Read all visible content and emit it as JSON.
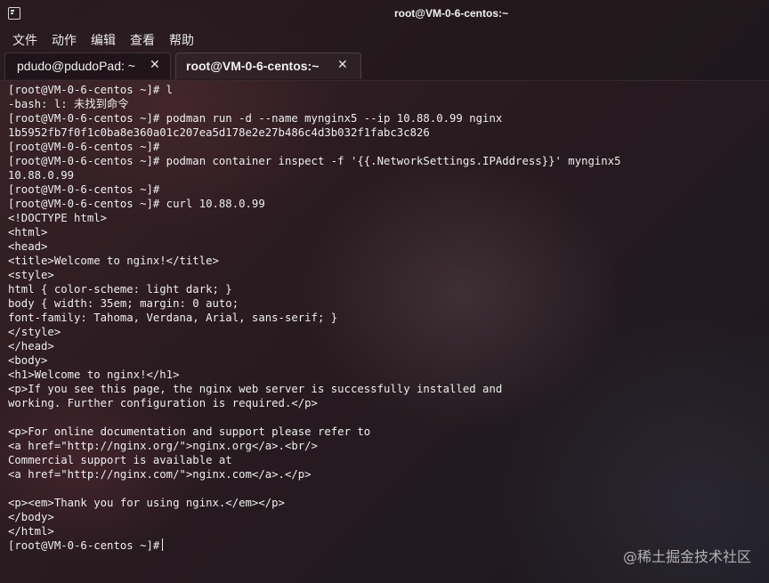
{
  "window": {
    "title": "root@VM-0-6-centos:~"
  },
  "menu": {
    "items": [
      "文件",
      "动作",
      "编辑",
      "查看",
      "帮助"
    ]
  },
  "tabs": [
    {
      "label": "pdudo@pdudoPad: ~",
      "close": "✕",
      "active": false
    },
    {
      "label": "root@VM-0-6-centos:~",
      "close": "✕",
      "active": true
    }
  ],
  "terminal": {
    "lines": [
      "[root@VM-0-6-centos ~]# l",
      "-bash: l: 未找到命令",
      "[root@VM-0-6-centos ~]# podman run -d --name mynginx5 --ip 10.88.0.99 nginx",
      "1b5952fb7f0f1c0ba8e360a01c207ea5d178e2e27b486c4d3b032f1fabc3c826",
      "[root@VM-0-6-centos ~]#",
      "[root@VM-0-6-centos ~]# podman container inspect -f '{{.NetworkSettings.IPAddress}}' mynginx5",
      "10.88.0.99",
      "[root@VM-0-6-centos ~]#",
      "[root@VM-0-6-centos ~]# curl 10.88.0.99",
      "<!DOCTYPE html>",
      "<html>",
      "<head>",
      "<title>Welcome to nginx!</title>",
      "<style>",
      "html { color-scheme: light dark; }",
      "body { width: 35em; margin: 0 auto;",
      "font-family: Tahoma, Verdana, Arial, sans-serif; }",
      "</style>",
      "</head>",
      "<body>",
      "<h1>Welcome to nginx!</h1>",
      "<p>If you see this page, the nginx web server is successfully installed and",
      "working. Further configuration is required.</p>",
      "",
      "<p>For online documentation and support please refer to",
      "<a href=\"http://nginx.org/\">nginx.org</a>.<br/>",
      "Commercial support is available at",
      "<a href=\"http://nginx.com/\">nginx.com</a>.</p>",
      "",
      "<p><em>Thank you for using nginx.</em></p>",
      "</body>",
      "</html>"
    ],
    "prompt": "[root@VM-0-6-centos ~]#"
  },
  "watermark": "@稀土掘金技术社区",
  "icons": {
    "app": "terminal-icon",
    "close": "close-icon"
  }
}
